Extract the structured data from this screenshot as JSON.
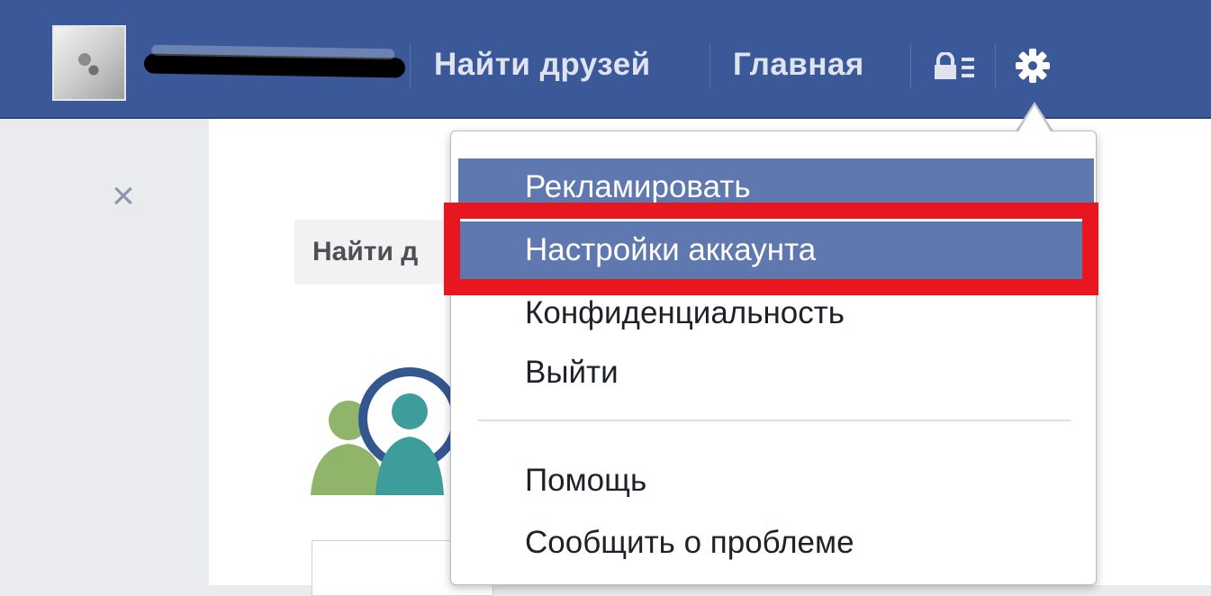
{
  "topbar": {
    "find_friends": "Найти друзей",
    "home": "Главная"
  },
  "background": {
    "find_friends_header": "Найти д"
  },
  "dropdown": {
    "items": [
      "Рекламировать",
      "Настройки аккаунта",
      "Конфиденциальность",
      "Выйти",
      "Помощь",
      "Сообщить о проблеме"
    ]
  },
  "colors": {
    "brand_blue": "#3b5998",
    "menu_highlight": "#5f78b0",
    "annotation_red": "#e8161e"
  },
  "icons": [
    "close-icon",
    "lock-icon",
    "gear-icon",
    "friends-illustration"
  ]
}
